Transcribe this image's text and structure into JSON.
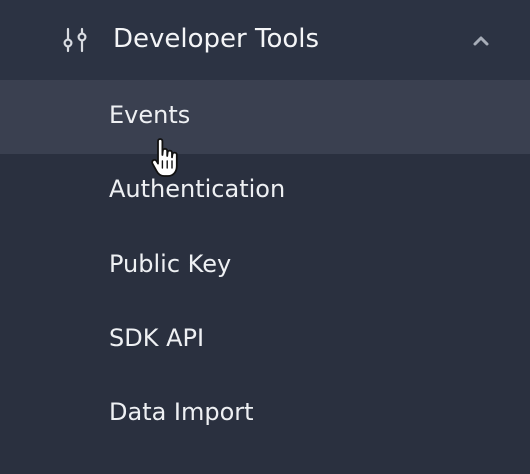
{
  "section": {
    "title": "Developer Tools",
    "icon": "sliders-icon",
    "toggle_icon": "chevron-up-icon",
    "expanded": true
  },
  "nav": {
    "items": [
      {
        "label": "Events",
        "state": "hover"
      },
      {
        "label": "Authentication"
      },
      {
        "label": "Public Key"
      },
      {
        "label": "SDK API"
      },
      {
        "label": "Data Import"
      }
    ]
  },
  "cursor": {
    "icon": "hand-pointer-icon"
  },
  "colors": {
    "background": "#2a303f",
    "header_background": "#2c3343",
    "hover_background": "#3a4050",
    "text": "#eef0f3"
  }
}
